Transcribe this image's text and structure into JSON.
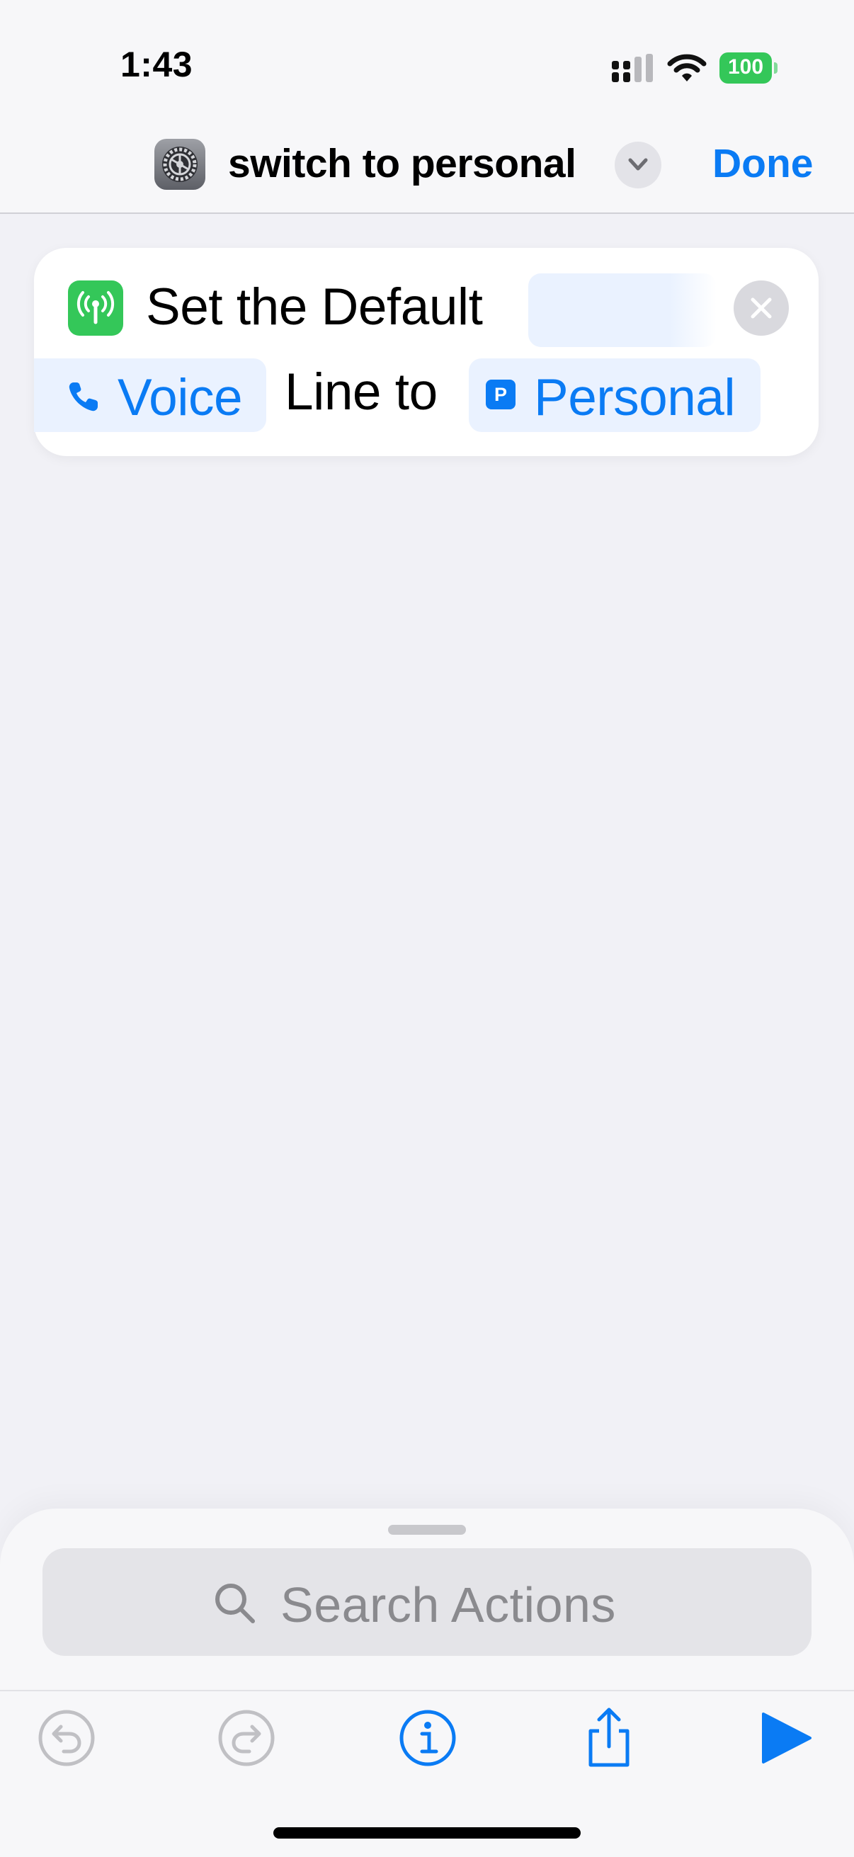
{
  "status_bar": {
    "time": "1:43",
    "battery_level": "100",
    "icons": [
      "cellular-signal-icon",
      "wifi-icon",
      "battery-icon"
    ]
  },
  "nav_bar": {
    "app_icon": "settings-gear-icon",
    "title": "switch to personal",
    "title_menu_icon": "chevron-down-icon",
    "done_label": "Done"
  },
  "action": {
    "icon": "cellular-antenna-icon",
    "icon_color": "#34c759",
    "text_before": "Set the Default",
    "blank_parameter": "",
    "line_type_parameter": {
      "icon": "phone-icon",
      "label": "Voice"
    },
    "text_middle": "Line to",
    "line_parameter": {
      "badge": "P",
      "label": "Personal"
    },
    "remove_icon": "close-icon"
  },
  "bottom_sheet": {
    "search_placeholder": "Search Actions",
    "search_icon": "magnifying-glass-icon"
  },
  "toolbar": {
    "buttons": [
      {
        "name": "undo",
        "icon": "undo-icon",
        "enabled": false
      },
      {
        "name": "redo",
        "icon": "redo-icon",
        "enabled": false
      },
      {
        "name": "info",
        "icon": "info-icon",
        "enabled": true
      },
      {
        "name": "share",
        "icon": "share-icon",
        "enabled": true
      },
      {
        "name": "run",
        "icon": "play-icon",
        "enabled": true
      }
    ]
  },
  "colors": {
    "accent": "#0a7bf4",
    "background": "#f1f1f6",
    "green": "#34c759",
    "disabled": "#c0c0c4"
  }
}
